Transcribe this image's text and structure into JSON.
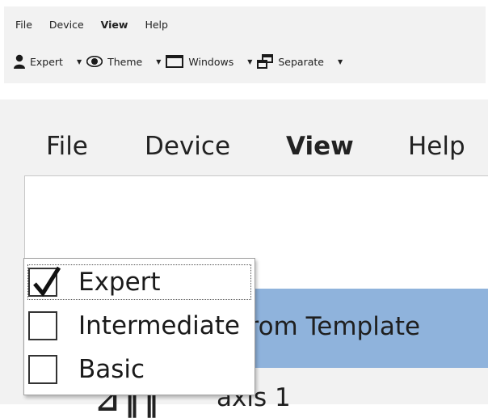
{
  "menu": {
    "items": [
      {
        "label": "File",
        "active": false
      },
      {
        "label": "Device",
        "active": false
      },
      {
        "label": "View",
        "active": true
      },
      {
        "label": "Help",
        "active": false
      }
    ]
  },
  "toolbar": {
    "items": [
      {
        "label": "Expert",
        "icon": "user-icon"
      },
      {
        "label": "Theme",
        "icon": "eye-icon"
      },
      {
        "label": "Windows",
        "icon": "window-icon"
      },
      {
        "label": "Separate",
        "icon": "separate-windows-icon"
      }
    ]
  },
  "user_level_menu": {
    "items": [
      {
        "label": "Expert",
        "checked": true
      },
      {
        "label": "Intermediate",
        "checked": false
      },
      {
        "label": "Basic",
        "checked": false
      }
    ]
  },
  "background": {
    "selected_row_text": "ed from Template",
    "tree_item_text": "axis 1"
  },
  "colors": {
    "panel_bg": "#f2f2f2",
    "selection": "#8fb3dc"
  }
}
